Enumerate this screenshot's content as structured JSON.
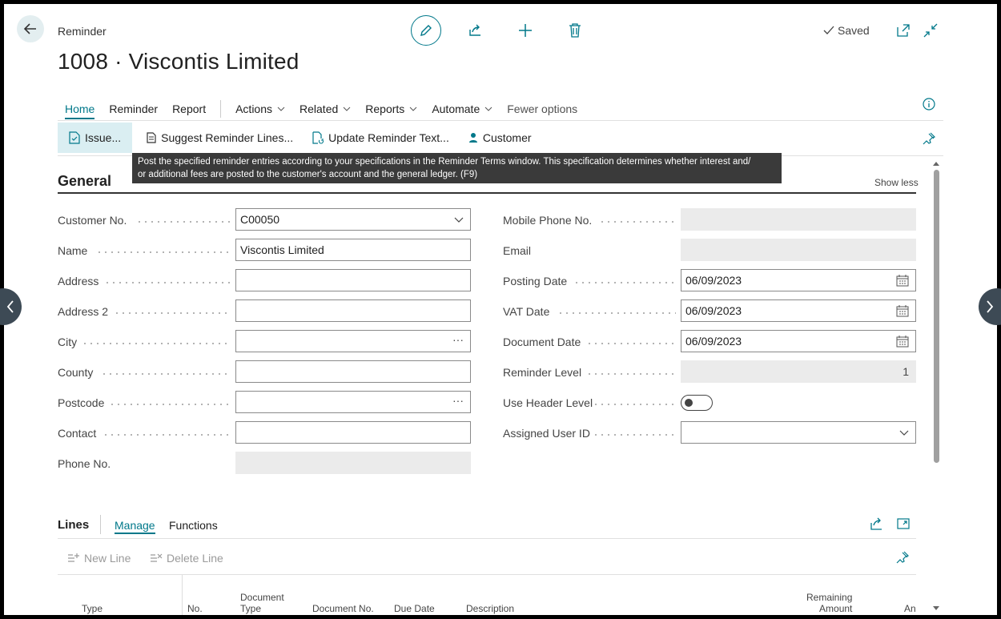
{
  "header": {
    "caption": "Reminder",
    "title": "1008 · Viscontis Limited",
    "saved_label": "Saved"
  },
  "actionbar": {
    "items": [
      "Home",
      "Reminder",
      "Report",
      "Actions",
      "Related",
      "Reports",
      "Automate",
      "Fewer options"
    ]
  },
  "promoted": {
    "issue": "Issue...",
    "suggest": "Suggest Reminder Lines...",
    "update": "Update Reminder Text...",
    "customer": "Customer"
  },
  "tooltip": {
    "line1": "Post the specified reminder entries according to your specifications in the Reminder Terms window. This specification determines whether interest and/",
    "line2": "or additional fees are posted to the customer's account and the general ledger. (F9)"
  },
  "general": {
    "title": "General",
    "show_less": "Show less",
    "left": [
      {
        "label": "Customer No.",
        "value": "C00050"
      },
      {
        "label": "Name",
        "value": "Viscontis Limited"
      },
      {
        "label": "Address",
        "value": ""
      },
      {
        "label": "Address 2",
        "value": ""
      },
      {
        "label": "City",
        "value": ""
      },
      {
        "label": "County",
        "value": ""
      },
      {
        "label": "Postcode",
        "value": ""
      },
      {
        "label": "Contact",
        "value": ""
      },
      {
        "label": "Phone No.",
        "value": ""
      }
    ],
    "right": [
      {
        "label": "Mobile Phone No.",
        "value": ""
      },
      {
        "label": "Email",
        "value": ""
      },
      {
        "label": "Posting Date",
        "value": "06/09/2023"
      },
      {
        "label": "VAT Date",
        "value": "06/09/2023"
      },
      {
        "label": "Document Date",
        "value": "06/09/2023"
      },
      {
        "label": "Reminder Level",
        "value": "1"
      },
      {
        "label": "Use Header Level",
        "value": ""
      },
      {
        "label": "Assigned User ID",
        "value": ""
      }
    ],
    "use_header_level": false
  },
  "lines": {
    "title": "Lines",
    "tabs": [
      "Manage",
      "Functions"
    ],
    "actions": [
      "New Line",
      "Delete Line"
    ],
    "columns": {
      "type": "Type",
      "no": "No.",
      "doc_type_1": "Document",
      "doc_type_2": "Type",
      "doc_no": "Document No.",
      "due_date": "Due Date",
      "description": "Description",
      "remaining_1": "Remaining",
      "remaining_2": "Amount",
      "amount_partial": "An"
    }
  },
  "colors": {
    "accent": "#00788a",
    "tooltip_bg": "#3a3a3a",
    "disabled_bg": "#ebebeb"
  }
}
